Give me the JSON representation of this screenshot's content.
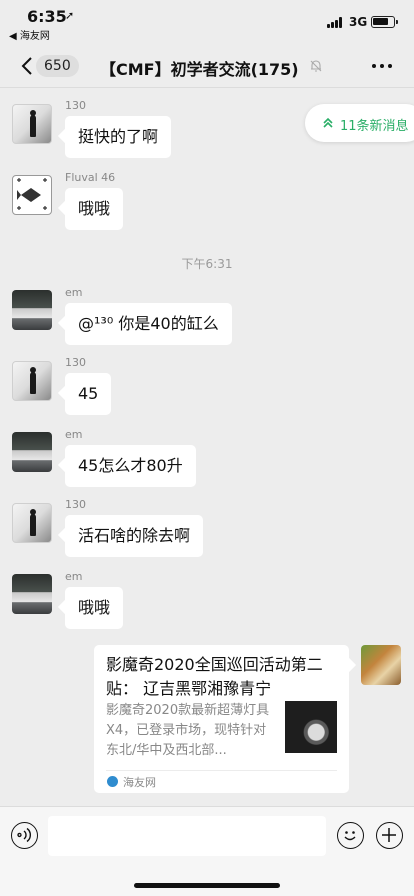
{
  "status_bar": {
    "time": "6:35",
    "location_arrow": "➚",
    "back_app": "◀ 海友网",
    "network": "3G"
  },
  "nav": {
    "back_badge": "650",
    "title": "【CMF】初学者交流(175)",
    "icons": {
      "back": "chevron-left-icon",
      "mute": "bell-mute-icon",
      "more": "more-icon"
    }
  },
  "new_messages": {
    "label": "11条新消息",
    "color": "#2aae67"
  },
  "messages": [
    {
      "sender": "130",
      "text": "挺快的了啊",
      "avatar": "person"
    },
    {
      "sender": "Fluval 46",
      "text": "哦哦",
      "avatar": "fish"
    },
    {
      "sender": "em",
      "text": "@¹³⁰ 你是40的缸么",
      "avatar": "car"
    },
    {
      "sender": "130",
      "text": "45",
      "avatar": "person"
    },
    {
      "sender": "em",
      "text": "45怎么才80升",
      "avatar": "car"
    },
    {
      "sender": "130",
      "text": "活石啥的除去啊",
      "avatar": "person"
    },
    {
      "sender": "em",
      "text": "哦哦",
      "avatar": "car"
    }
  ],
  "timestamp": "下午6:31",
  "link_card": {
    "title": "影魔奇2020全国巡回活动第二贴： 辽吉黑鄂湘豫青宁",
    "description": "影魔奇2020款最新超薄灯具X4，已登录市场，现特针对东北/华中及西北部...",
    "source": "海友网"
  },
  "input_bar": {
    "placeholder": ""
  }
}
